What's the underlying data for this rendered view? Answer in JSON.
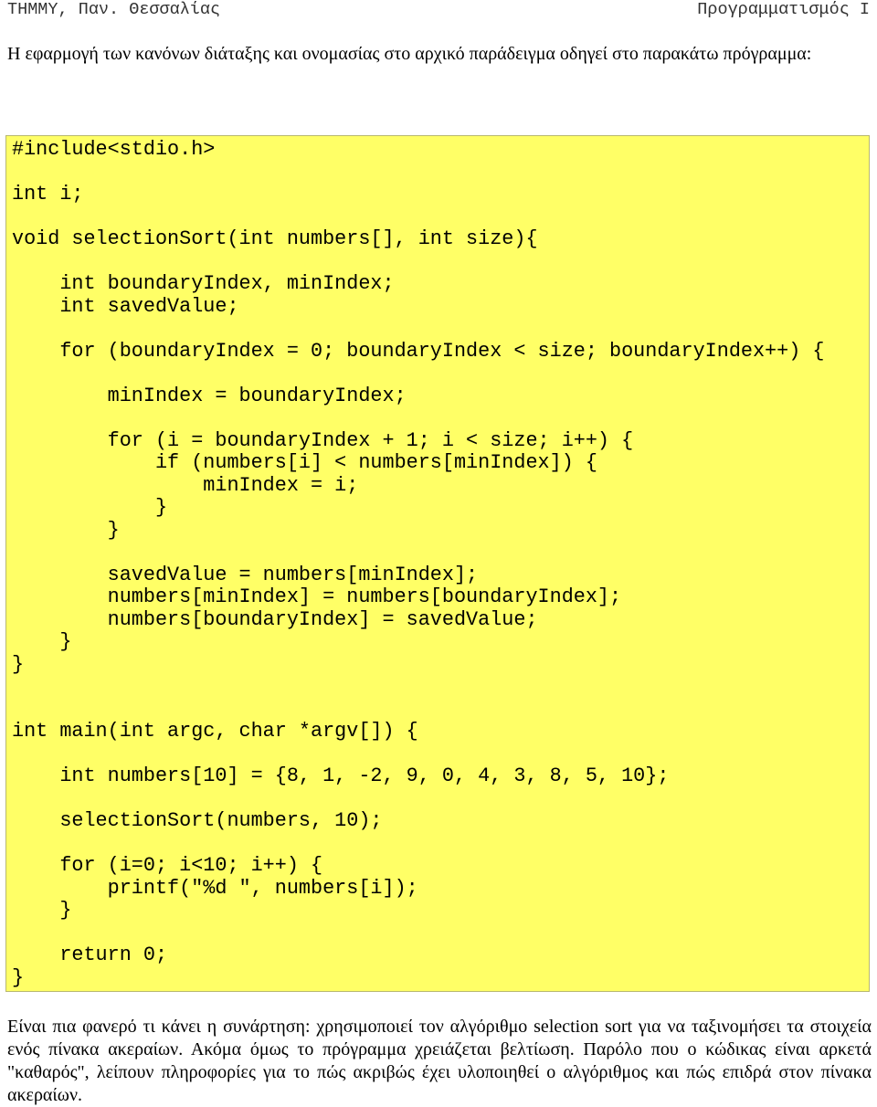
{
  "header": {
    "left": "ΤΗΜΜΥ, Παν. Θεσσαλίας",
    "right": "Προγραμματισμός Ι"
  },
  "intro": "Η εφαρμογή των κανόνων διάταξης και ονομασίας στο αρχικό παράδειγμα οδηγεί στο παρακάτω πρόγραμμα:",
  "code_lines": [
    "#include<stdio.h>",
    "",
    "int i;",
    "",
    "void selectionSort(int numbers[], int size){",
    "",
    "    int boundaryIndex, minIndex;",
    "    int savedValue;",
    "",
    "    for (boundaryIndex = 0; boundaryIndex < size; boundaryIndex++) {",
    "",
    "        minIndex = boundaryIndex;",
    "",
    "        for (i = boundaryIndex + 1; i < size; i++) {",
    "            if (numbers[i] < numbers[minIndex]) {",
    "                minIndex = i;",
    "            }",
    "        }",
    "",
    "        savedValue = numbers[minIndex];",
    "        numbers[minIndex] = numbers[boundaryIndex];",
    "        numbers[boundaryIndex] = savedValue;",
    "    }",
    "}",
    "",
    "",
    "int main(int argc, char *argv[]) {",
    "",
    "    int numbers[10] = {8, 1, -2, 9, 0, 4, 3, 8, 5, 10};",
    "",
    "    selectionSort(numbers, 10);",
    "",
    "    for (i=0; i<10; i++) {",
    "        printf(\"%d \", numbers[i]);",
    "    }",
    "",
    "    return 0;",
    "}"
  ],
  "outro": "Είναι πια φανερό τι κάνει η συνάρτηση: χρησιμοποιεί τον αλγόριθμο selection sort για να ταξινομήσει τα στοιχεία ενός πίνακα ακεραίων. Ακόμα όμως το πρόγραμμα χρειάζεται βελτίωση. Παρόλο που ο κώδικας είναι αρκετά \"καθαρός\", λείπουν πληροφορίες για το πώς ακριβώς έχει υλοποιηθεί ο αλγόριθμος και πώς επιδρά στον πίνακα ακεραίων.",
  "colors": {
    "code_background": "#ffff66"
  }
}
